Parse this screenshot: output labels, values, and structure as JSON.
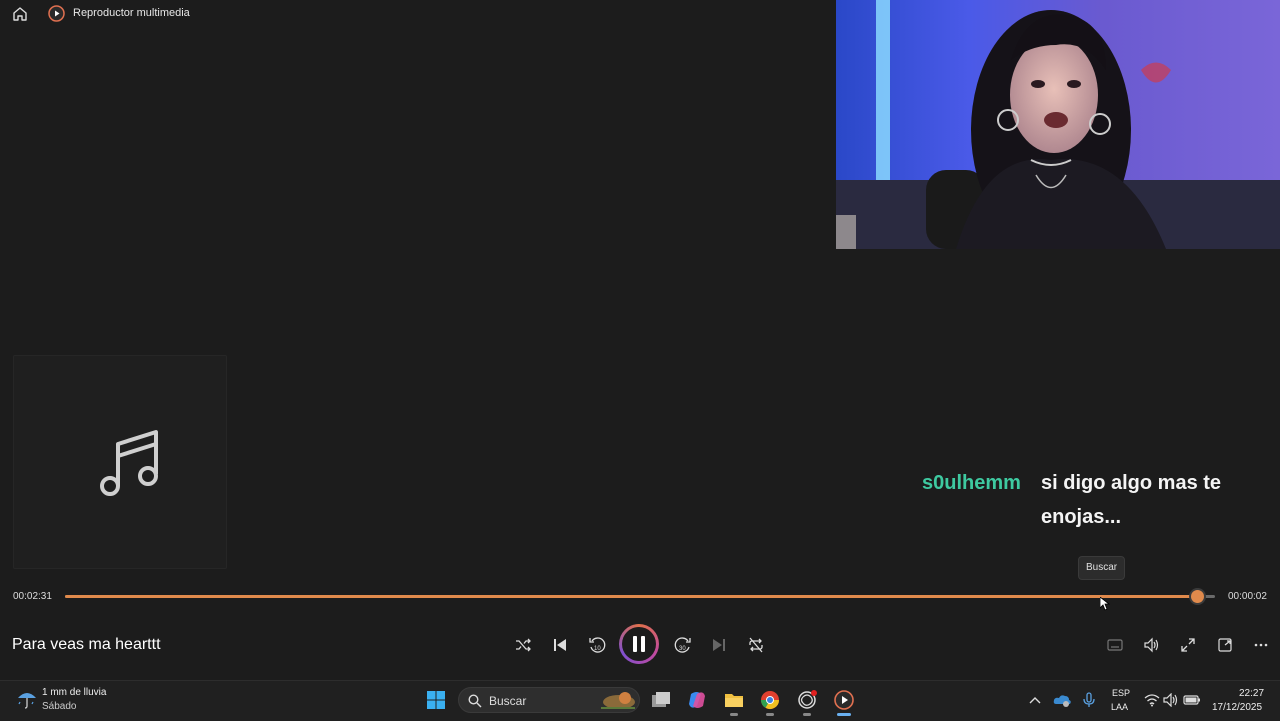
{
  "app": {
    "title": "Reproductor multimedia"
  },
  "chat": {
    "username": "s0ulhemm",
    "message": "si digo algo mas te enojas..."
  },
  "tooltip": {
    "text": "Buscar"
  },
  "player": {
    "elapsed": "00:02:31",
    "remaining": "00:00:02",
    "progress": 0.984,
    "song_title": "Para veas ma hearttt",
    "accent_color": "#e08a4c",
    "controls": [
      "shuffle-icon",
      "previous-icon",
      "rewind-10-icon",
      "pause-icon",
      "forward-30-icon",
      "next-icon",
      "repeat-off-icon"
    ],
    "right_controls": [
      "subtitles-icon",
      "volume-icon",
      "fullscreen-icon",
      "mini-player-icon",
      "more-icon"
    ]
  },
  "taskbar": {
    "weather_temp": "1 mm de lluvia",
    "weather_day": "Sábado",
    "search_label": "Buscar",
    "lang_top": "ESP",
    "lang_bottom": "LAA",
    "time": "22:27",
    "date": "17/12/2025"
  }
}
